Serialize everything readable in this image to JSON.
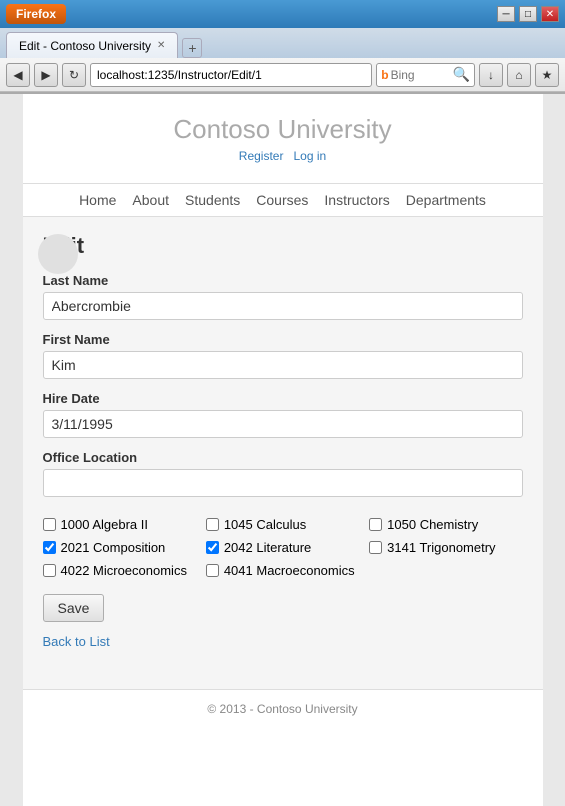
{
  "browser": {
    "firefox_label": "Firefox",
    "tab_title": "Edit - Contoso University",
    "url": "localhost:1235/Instructor/Edit/1",
    "search_placeholder": "Bing",
    "new_tab_symbol": "+",
    "back_symbol": "◀",
    "forward_symbol": "▶",
    "refresh_symbol": "↻",
    "home_symbol": "⌂",
    "minimize_symbol": "─",
    "maximize_symbol": "□",
    "close_symbol": "✕"
  },
  "site": {
    "title": "Contoso University",
    "auth": {
      "register": "Register",
      "login": "Log in"
    },
    "nav": [
      "Home",
      "About",
      "Students",
      "Courses",
      "Instructors",
      "Departments"
    ],
    "footer": "© 2013 - Contoso University"
  },
  "form": {
    "heading": "Edit",
    "fields": {
      "last_name_label": "Last Name",
      "last_name_value": "Abercrombie",
      "first_name_label": "First Name",
      "first_name_value": "Kim",
      "hire_date_label": "Hire Date",
      "hire_date_value": "3/11/1995",
      "office_label": "Office Location",
      "office_value": ""
    },
    "courses": [
      {
        "id": "1000",
        "name": "Algebra II",
        "checked": false
      },
      {
        "id": "1045",
        "name": "Calculus",
        "checked": false
      },
      {
        "id": "1050",
        "name": "Chemistry",
        "checked": false
      },
      {
        "id": "2021",
        "name": "Composition",
        "checked": true
      },
      {
        "id": "2042",
        "name": "Literature",
        "checked": true
      },
      {
        "id": "3141",
        "name": "Trigonometry",
        "checked": false
      },
      {
        "id": "4022",
        "name": "Microeconomics",
        "checked": false
      },
      {
        "id": "4041",
        "name": "Macroeconomics",
        "checked": false
      }
    ],
    "save_label": "Save",
    "back_link_label": "Back to List"
  }
}
